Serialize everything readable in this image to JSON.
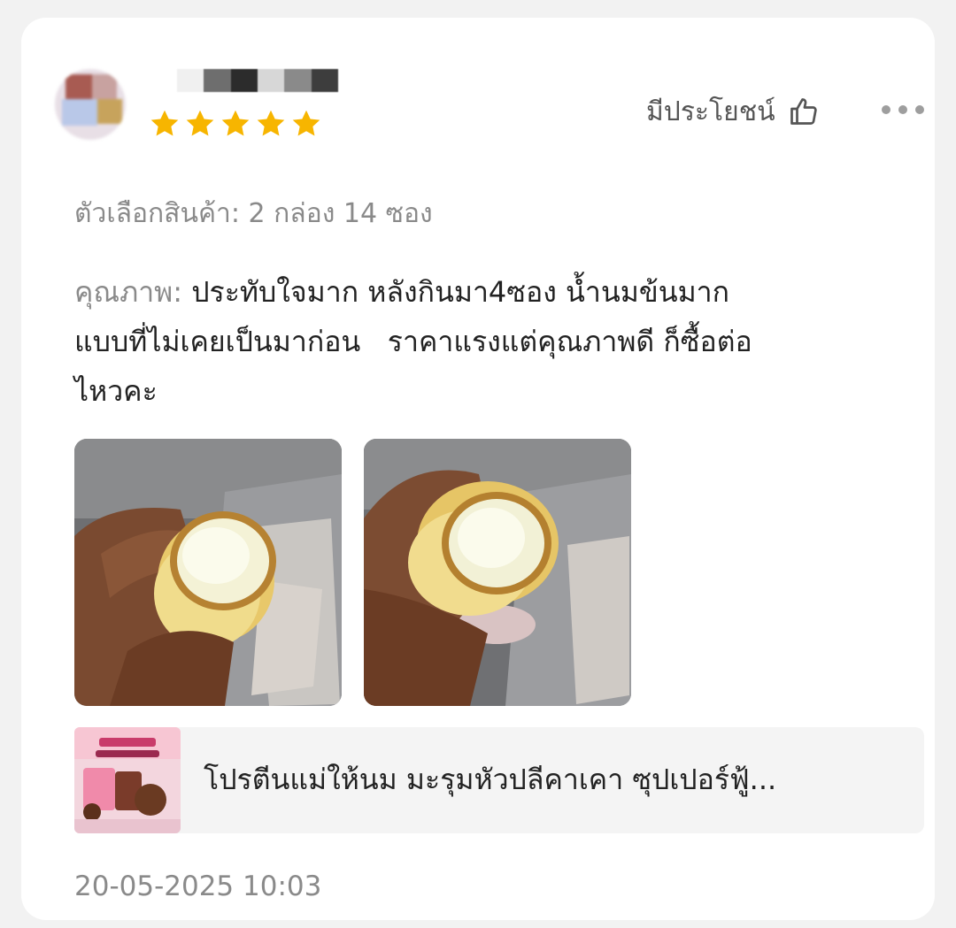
{
  "review": {
    "helpful_label": "มีประโยชน์",
    "variant": "ตัวเลือกสินค้า: 2 กล่อง 14 ซอง",
    "quality_label": "คุณภาพ:",
    "quality_text_lines": [
      "ประทับใจมาก หลังกินมา4ซอง น้ำนมข้นมาก",
      "แบบที่ไม่เคยเป็นมาก่อน   ราคาแรงแต่คุณภาพดี ก็ซื้อต่อ",
      "ไหวคะ"
    ],
    "rating": 5,
    "product_name": "โปรตีนแม่ให้นม มะรุมหัวปลีคาเคา ซุปเปอร์ฟู้...",
    "timestamp": "20-05-2025 10:03"
  },
  "icons": {
    "thumb": "thumbs-up-icon",
    "more": "more-dots-icon",
    "star": "star-icon"
  },
  "colors": {
    "star": "#f7b500",
    "card_bg": "#ffffff",
    "page_bg": "#f2f2f2",
    "muted_text": "#8a8a8a"
  }
}
